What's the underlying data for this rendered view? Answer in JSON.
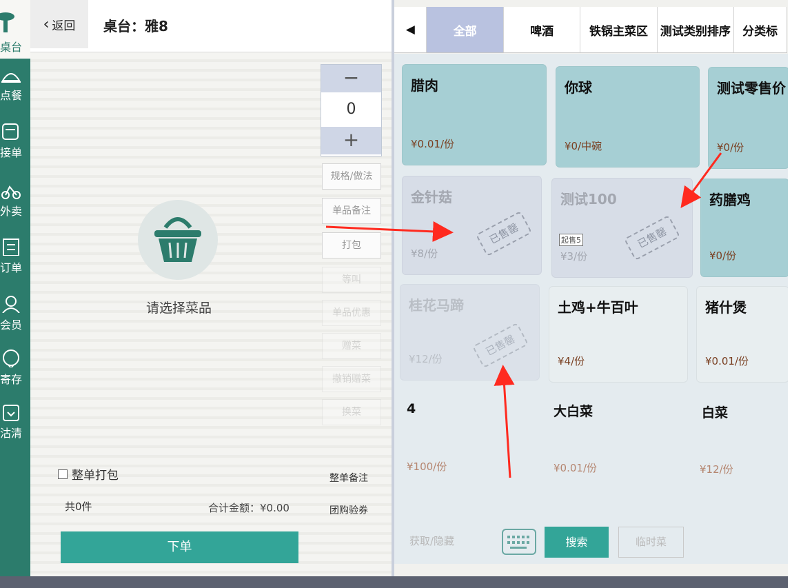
{
  "nav": {
    "items": [
      {
        "label": "桌台",
        "icon": "table-icon"
      },
      {
        "label": "点餐",
        "icon": "bell-icon"
      },
      {
        "label": "接单",
        "icon": "receive-order-icon"
      },
      {
        "label": "外卖",
        "icon": "delivery-icon"
      },
      {
        "label": "订单",
        "icon": "order-list-icon"
      },
      {
        "label": "会员",
        "icon": "member-icon"
      },
      {
        "label": "寄存",
        "icon": "storage-icon"
      },
      {
        "label": "沽清",
        "icon": "soldout-icon"
      }
    ]
  },
  "header": {
    "back_label": "返回",
    "back_arrow": "‹",
    "table_title": "桌台：雅8"
  },
  "cart": {
    "empty_text": "请选择菜品",
    "whole_pack_label": "整单打包",
    "count_text": "共0件",
    "total_text": "合计金额：¥0.00",
    "order_button": "下单"
  },
  "qty": {
    "minus": "−",
    "value": "0",
    "plus": "+"
  },
  "side_buttons": [
    "规格/做法",
    "单品备注",
    "打包",
    "等叫",
    "单品优惠",
    "赠菜",
    "撤销赠菜",
    "换菜"
  ],
  "bottom_actions": {
    "whole_remark": "整单备注",
    "group_voucher": "团购验券"
  },
  "categories": {
    "left_arrow": "◀",
    "items": [
      "全部",
      "啤酒",
      "铁锅主菜区",
      "测试类别排序",
      "分类标"
    ],
    "active_index": 0
  },
  "dishes": [
    {
      "name": "腊肉",
      "price": "¥0.01/份",
      "state": "available"
    },
    {
      "name": "你球",
      "price": "¥0/中碗",
      "state": "available"
    },
    {
      "name": "测试零售价",
      "price": "¥0/份",
      "state": "available"
    },
    {
      "name": "金针菇",
      "price": "¥8/份",
      "state": "sold_out",
      "stamp": "已售罄"
    },
    {
      "name": "测试100",
      "price": "¥3/份",
      "state": "sold_out",
      "stamp": "已售罄",
      "tag": "起售5"
    },
    {
      "name": "药膳鸡",
      "price": "¥0/份",
      "state": "available"
    },
    {
      "name": "桂花马蹄",
      "price": "¥12/份",
      "state": "sold_out",
      "stamp": "已售罄"
    },
    {
      "name": "土鸡+牛百叶",
      "price": "¥4/份",
      "state": "available"
    },
    {
      "name": "猪什煲",
      "price": "¥0.01/份",
      "state": "available"
    },
    {
      "name": "4",
      "price": "¥100/份",
      "state": "available"
    },
    {
      "name": "大白菜",
      "price": "¥0.01/份",
      "state": "available"
    },
    {
      "name": "白菜",
      "price": "¥12/份",
      "state": "available"
    }
  ],
  "footer": {
    "prev_next": "获取/隐藏",
    "keyboard_icon": "keyboard-icon",
    "search_button": "搜索",
    "temp_dish_button": "临时菜"
  },
  "colors": {
    "nav_bg": "#2c7c6c",
    "accent": "#33a598",
    "card_available": "#a6cfd4",
    "card_soldout": "#d7dde7",
    "active_tab": "#b9c2e0",
    "annotation_arrow": "#ff2a1f"
  }
}
